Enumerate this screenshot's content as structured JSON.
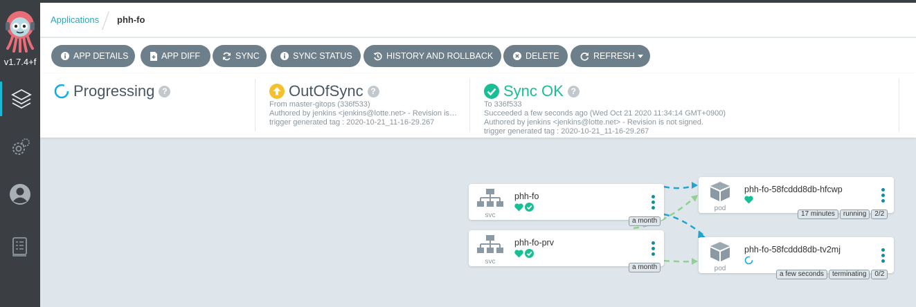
{
  "sidebar": {
    "version": "v1.7.4+f",
    "items": [
      "applications-icon",
      "settings-icon",
      "user-icon",
      "docs-icon"
    ]
  },
  "breadcrumb": {
    "root": "Applications",
    "current": "phh-fo"
  },
  "toolbar": {
    "buttons": [
      {
        "label": "APP DETAILS",
        "icon": "info-icon"
      },
      {
        "label": "APP DIFF",
        "icon": "file-plus-icon"
      },
      {
        "label": "SYNC",
        "icon": "sync-icon"
      },
      {
        "label": "SYNC STATUS",
        "icon": "info-icon"
      },
      {
        "label": "HISTORY AND ROLLBACK",
        "icon": "history-icon"
      },
      {
        "label": "DELETE",
        "icon": "times-circle-icon"
      },
      {
        "label": "REFRESH",
        "icon": "refresh-icon"
      }
    ]
  },
  "status": {
    "health": {
      "label": "Progressing",
      "color": "#0dadea"
    },
    "sync": {
      "label": "OutOfSync",
      "color": "#f4c030",
      "from": "From master-gitops (336f533)",
      "authored": "Authored by jenkins <jenkins@lotte.net> - Revision is…",
      "tag": "trigger generated tag : 2020-10-21_11-16-29.267"
    },
    "operation": {
      "label": "Sync OK",
      "color": "#18be94",
      "to": "To 336f533",
      "succeeded": "Succeeded a few seconds ago (Wed Oct 21 2020 11:34:14 GMT+0900)",
      "authored": "Authored by jenkins <jenkins@lotte.net> - Revision is not signed.",
      "tag": "trigger generated tag : 2020-10-21_11-16-29.267"
    }
  },
  "graph": {
    "nodes": [
      {
        "name": "phh-fo",
        "kind": "svc",
        "age": "a month"
      },
      {
        "name": "phh-fo-prv",
        "kind": "svc",
        "age": "a month"
      },
      {
        "name": "phh-fo-58fcddd8db-hfcwp",
        "kind": "pod",
        "info": [
          "17 minutes",
          "running",
          "2/2"
        ]
      },
      {
        "name": "phh-fo-58fcddd8db-tv2mj",
        "kind": "pod",
        "info": [
          "a few seconds",
          "terminating",
          "0/2"
        ]
      }
    ],
    "colors": {
      "healthy": "#18be94",
      "progressing": "#0dadea",
      "edge_blue": "#1ea5d2",
      "edge_green": "#8fd18f",
      "kebab": "#0b8fa3"
    }
  }
}
